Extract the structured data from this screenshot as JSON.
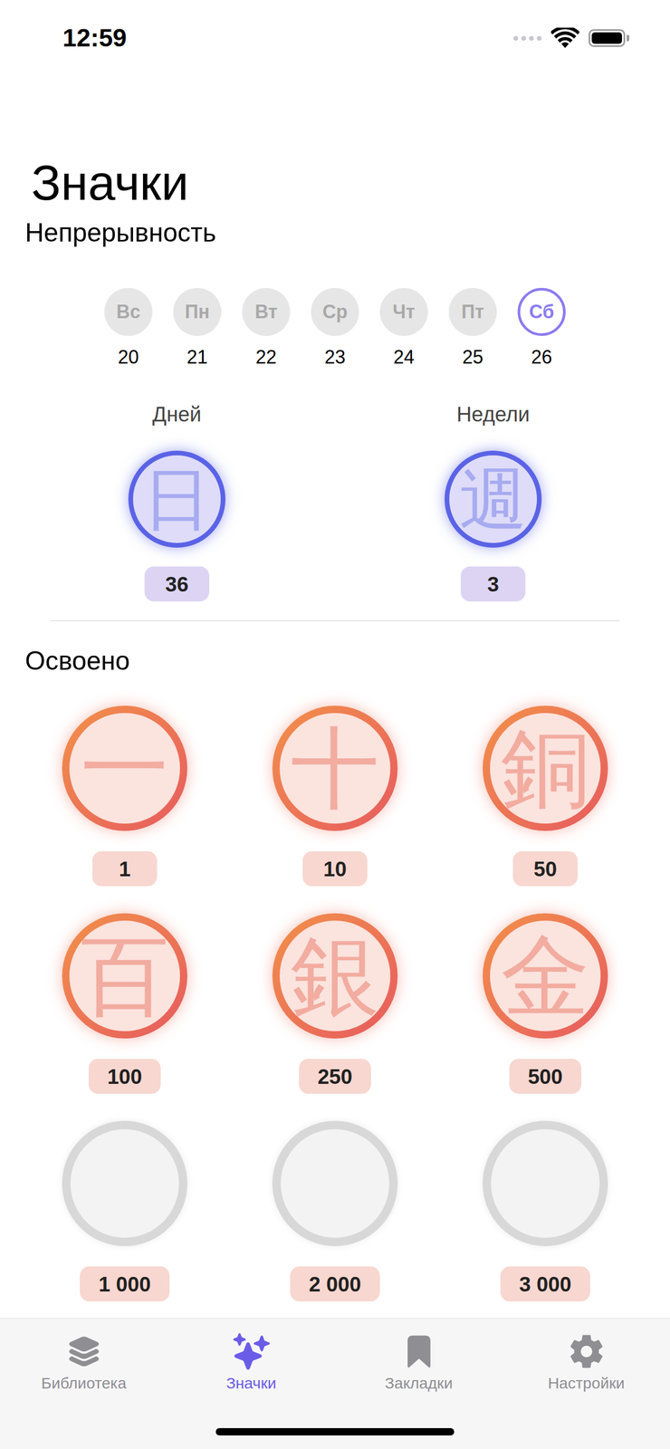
{
  "status_bar": {
    "time": "12:59"
  },
  "title": "Значки",
  "streak": {
    "heading": "Непрерывность",
    "days": [
      {
        "label": "Вс",
        "date": "20",
        "selected": false
      },
      {
        "label": "Пн",
        "date": "21",
        "selected": false
      },
      {
        "label": "Вт",
        "date": "22",
        "selected": false
      },
      {
        "label": "Ср",
        "date": "23",
        "selected": false
      },
      {
        "label": "Чт",
        "date": "24",
        "selected": false
      },
      {
        "label": "Пт",
        "date": "25",
        "selected": false
      },
      {
        "label": "Сб",
        "date": "26",
        "selected": true
      }
    ],
    "counters": [
      {
        "label": "Дней",
        "glyph": "日",
        "value": "36"
      },
      {
        "label": "Недели",
        "glyph": "週",
        "value": "3"
      }
    ]
  },
  "mastered": {
    "heading": "Освоено",
    "badges": [
      {
        "glyph": "一",
        "value": "1",
        "earned": true
      },
      {
        "glyph": "十",
        "value": "10",
        "earned": true
      },
      {
        "glyph": "銅",
        "value": "50",
        "earned": true
      },
      {
        "glyph": "百",
        "value": "100",
        "earned": true
      },
      {
        "glyph": "銀",
        "value": "250",
        "earned": true
      },
      {
        "glyph": "金",
        "value": "500",
        "earned": true
      },
      {
        "glyph": "",
        "value": "1 000",
        "earned": false
      },
      {
        "glyph": "",
        "value": "2 000",
        "earned": false
      },
      {
        "glyph": "",
        "value": "3 000",
        "earned": false
      }
    ]
  },
  "tabs": [
    {
      "label": "Библиотека",
      "selected": false
    },
    {
      "label": "Значки",
      "selected": true
    },
    {
      "label": "Закладки",
      "selected": false
    },
    {
      "label": "Настройки",
      "selected": false
    }
  ]
}
